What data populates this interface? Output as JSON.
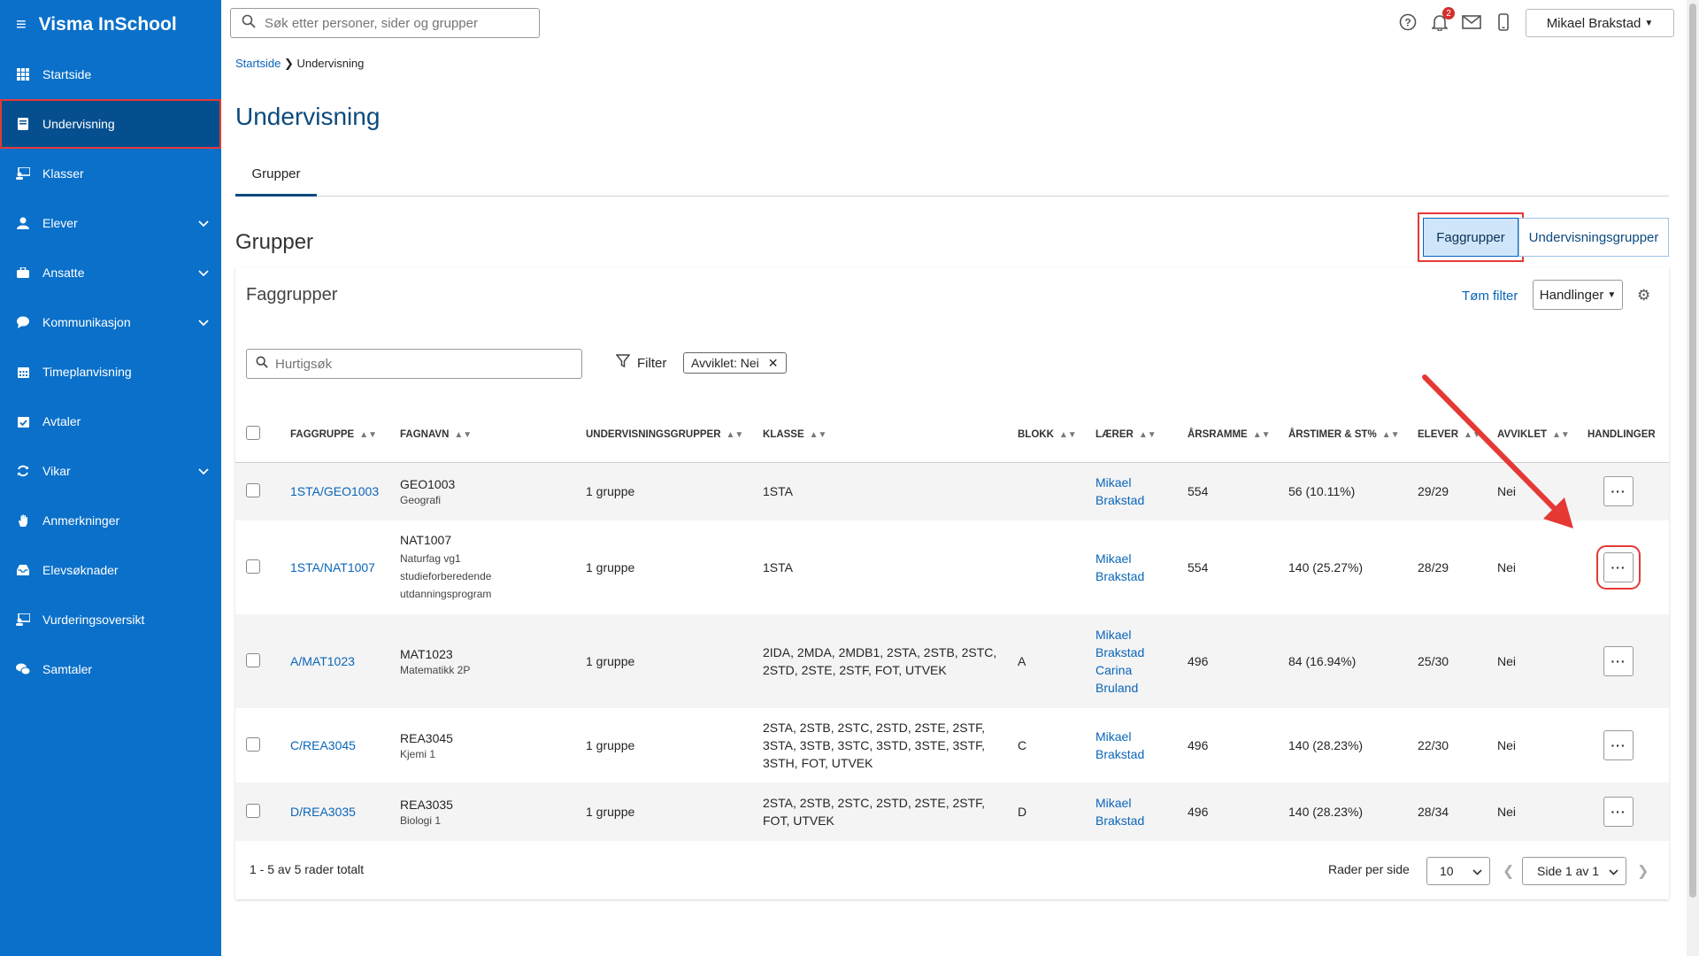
{
  "app": {
    "title": "Visma InSchool",
    "menu_icon": "hamburger-icon"
  },
  "search": {
    "placeholder": "Søk etter personer, sider og grupper"
  },
  "topbar": {
    "notifications_count": "2",
    "user_name": "Mikael Brakstad"
  },
  "sidebar": {
    "items": [
      {
        "label": "Startside",
        "icon": "grid-icon"
      },
      {
        "label": "Undervisning",
        "icon": "book-icon"
      },
      {
        "label": "Klasser",
        "icon": "class-icon"
      },
      {
        "label": "Elever",
        "icon": "student-icon"
      },
      {
        "label": "Ansatte",
        "icon": "briefcase-icon"
      },
      {
        "label": "Kommunikasjon",
        "icon": "chat-icon"
      },
      {
        "label": "Timeplanvisning",
        "icon": "calendar-icon"
      },
      {
        "label": "Avtaler",
        "icon": "calendar-check-icon"
      },
      {
        "label": "Vikar",
        "icon": "sync-icon"
      },
      {
        "label": "Anmerkninger",
        "icon": "hand-icon"
      },
      {
        "label": "Elevsøknader",
        "icon": "inbox-icon"
      },
      {
        "label": "Vurderingsoversikt",
        "icon": "assessment-icon"
      },
      {
        "label": "Samtaler",
        "icon": "conversation-icon"
      }
    ]
  },
  "breadcrumb": {
    "home": "Startside",
    "current": "Undervisning"
  },
  "page": {
    "title": "Undervisning",
    "tab": "Grupper",
    "section_title": "Grupper"
  },
  "toggle": {
    "left": "Faggrupper",
    "right": "Undervisningsgrupper"
  },
  "card": {
    "title": "Faggrupper",
    "clear_filter": "Tøm filter",
    "actions": "Handlinger",
    "quick_search_placeholder": "Hurtigsøk",
    "filter_label": "Filter",
    "chip": "Avviklet: Nei"
  },
  "table": {
    "headers": [
      "FAGGRUPPE",
      "FAGNAVN",
      "UNDERVISNINGSGRUPPER",
      "KLASSE",
      "BLOKK",
      "LÆRER",
      "ÅRSRAMME",
      "ÅRSTIMER & ST%",
      "ELEVER",
      "AVVIKLET",
      "HANDLINGER"
    ],
    "rows": [
      {
        "faggruppe": "1STA/GEO1003",
        "code": "GEO1003",
        "name": "Geografi",
        "ugrupper": "1 gruppe",
        "klasse": "1STA",
        "blokk": "",
        "teacher1": "Mikael",
        "teacher2": "Brakstad",
        "teacher3": "",
        "teacher4": "",
        "arsramme": "554",
        "arstimer": "56 (10.11%)",
        "elever": "29/29",
        "avviklet": "Nei"
      },
      {
        "faggruppe": "1STA/NAT1007",
        "code": "NAT1007",
        "name": "Naturfag vg1 studieforberedende utdanningsprogram",
        "ugrupper": "1 gruppe",
        "klasse": "1STA",
        "blokk": "",
        "teacher1": "Mikael",
        "teacher2": "Brakstad",
        "teacher3": "",
        "teacher4": "",
        "arsramme": "554",
        "arstimer": "140 (25.27%)",
        "elever": "28/29",
        "avviklet": "Nei"
      },
      {
        "faggruppe": "A/MAT1023",
        "code": "MAT1023",
        "name": "Matematikk 2P",
        "ugrupper": "1 gruppe",
        "klasse": "2IDA, 2MDA, 2MDB1, 2STA, 2STB, 2STC, 2STD, 2STE, 2STF, FOT, UTVEK",
        "blokk": "A",
        "teacher1": "Mikael",
        "teacher2": "Brakstad",
        "teacher3": "Carina",
        "teacher4": "Bruland",
        "arsramme": "496",
        "arstimer": "84 (16.94%)",
        "elever": "25/30",
        "avviklet": "Nei"
      },
      {
        "faggruppe": "C/REA3045",
        "code": "REA3045",
        "name": "Kjemi 1",
        "ugrupper": "1 gruppe",
        "klasse": "2STA, 2STB, 2STC, 2STD, 2STE, 2STF, 3STA, 3STB, 3STC, 3STD, 3STE, 3STF, 3STH, FOT, UTVEK",
        "blokk": "C",
        "teacher1": "Mikael",
        "teacher2": "Brakstad",
        "teacher3": "",
        "teacher4": "",
        "arsramme": "496",
        "arstimer": "140 (28.23%)",
        "elever": "22/30",
        "avviklet": "Nei"
      },
      {
        "faggruppe": "D/REA3035",
        "code": "REA3035",
        "name": "Biologi 1",
        "ugrupper": "1 gruppe",
        "klasse": "2STA, 2STB, 2STC, 2STD, 2STE, 2STF, FOT, UTVEK",
        "blokk": "D",
        "teacher1": "Mikael",
        "teacher2": "Brakstad",
        "teacher3": "",
        "teacher4": "",
        "arsramme": "496",
        "arstimer": "140 (28.23%)",
        "elever": "28/34",
        "avviklet": "Nei"
      }
    ]
  },
  "footer": {
    "count": "1 - 5 av 5 rader totalt",
    "rows_per_page_label": "Rader per side",
    "rows_per_page": "10",
    "page": "Side 1 av 1"
  },
  "colors": {
    "sidebar": "#0a70c9",
    "sidebar_active": "#064f8f",
    "accent": "#0a65b9",
    "highlight": "#e53935"
  }
}
